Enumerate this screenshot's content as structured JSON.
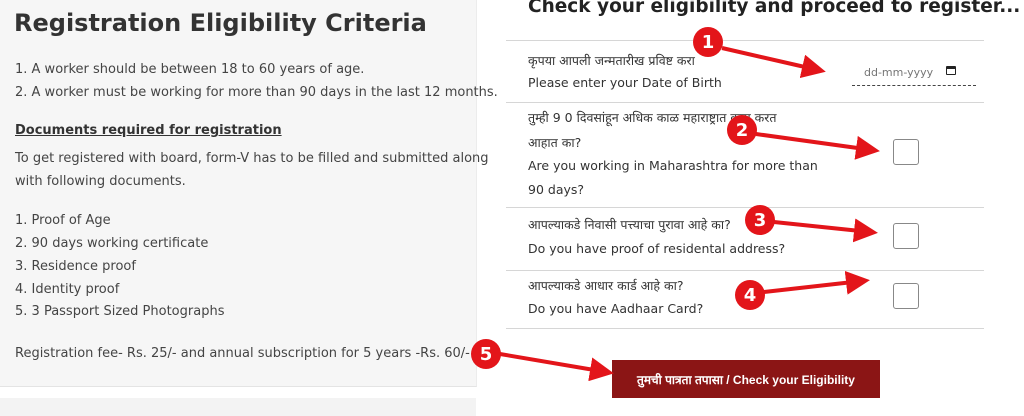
{
  "criteria": {
    "title": "Registration Eligibility Criteria",
    "rules": [
      "1. A worker should be between 18 to 60 years of age.",
      "2. A worker must be working for more than 90 days in the last 12 months."
    ],
    "docs_heading": "Documents required for registration",
    "docs_intro_line1": "To get registered with board, form-V has to be filled and submitted along",
    "docs_intro_line2": "with following documents.",
    "documents": [
      "1. Proof of Age",
      "2. 90 days working certificate",
      "3. Residence proof",
      "4. Identity proof",
      "5. 3 Passport Sized Photographs"
    ],
    "fee_note": "Registration fee- Rs. 25/- and annual subscription for 5 years -Rs. 60/-"
  },
  "eligibility": {
    "title": "Check your eligibility and proceed to register...",
    "dob": {
      "label_mr": "कृपया आपली जन्मतारीख प्रविष्ट करा",
      "label_en": "Please enter your Date of Birth",
      "placeholder": "dd-mm-yyyy"
    },
    "q_working": {
      "mr_line1": "तुम्ही 9 0 दिवसांहून अधिक काळ महाराष्ट्रात काम करत",
      "mr_line2": "आहात का?",
      "en_line1": "Are you working in Maharashtra for more than",
      "en_line2": "90 days?",
      "checked": false
    },
    "q_address": {
      "mr": "आपल्याकडे निवासी पत्त्याचा पुरावा आहे का?",
      "en": "Do you have proof of residental address?",
      "checked": false
    },
    "q_aadhaar": {
      "mr": "आपल्याकडे आधार कार्ड आहे का?",
      "en": "Do you have Aadhaar Card?",
      "checked": false
    },
    "check_button": "तुमची पात्रता तपासा / Check your Eligibility"
  },
  "annotations": {
    "badges": [
      "1",
      "2",
      "3",
      "4",
      "5"
    ],
    "color": "#e3151a"
  },
  "colors": {
    "button_bg": "#8b1515",
    "panel_bg": "#f6f6f6"
  }
}
